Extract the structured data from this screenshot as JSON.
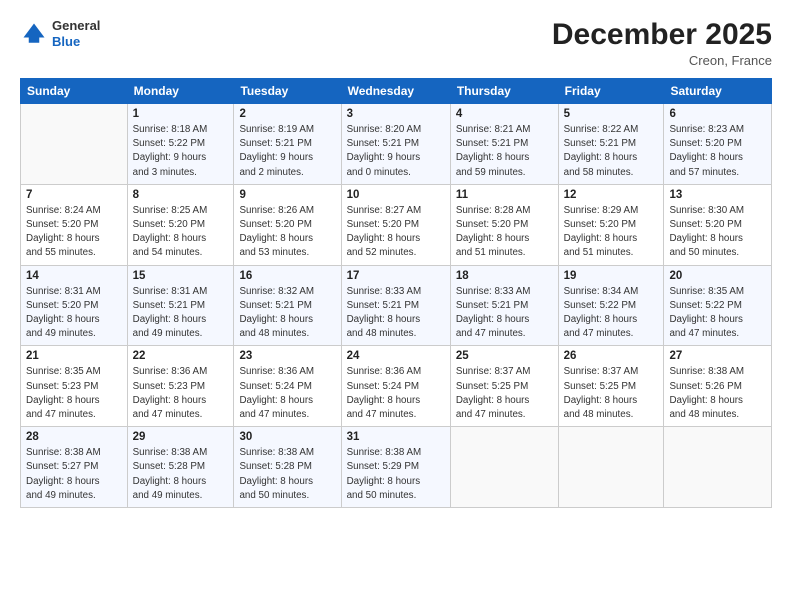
{
  "logo": {
    "general": "General",
    "blue": "Blue"
  },
  "title": "December 2025",
  "location": "Creon, France",
  "days_header": [
    "Sunday",
    "Monday",
    "Tuesday",
    "Wednesday",
    "Thursday",
    "Friday",
    "Saturday"
  ],
  "weeks": [
    [
      {
        "day": "",
        "info": ""
      },
      {
        "day": "1",
        "info": "Sunrise: 8:18 AM\nSunset: 5:22 PM\nDaylight: 9 hours\nand 3 minutes."
      },
      {
        "day": "2",
        "info": "Sunrise: 8:19 AM\nSunset: 5:21 PM\nDaylight: 9 hours\nand 2 minutes."
      },
      {
        "day": "3",
        "info": "Sunrise: 8:20 AM\nSunset: 5:21 PM\nDaylight: 9 hours\nand 0 minutes."
      },
      {
        "day": "4",
        "info": "Sunrise: 8:21 AM\nSunset: 5:21 PM\nDaylight: 8 hours\nand 59 minutes."
      },
      {
        "day": "5",
        "info": "Sunrise: 8:22 AM\nSunset: 5:21 PM\nDaylight: 8 hours\nand 58 minutes."
      },
      {
        "day": "6",
        "info": "Sunrise: 8:23 AM\nSunset: 5:20 PM\nDaylight: 8 hours\nand 57 minutes."
      }
    ],
    [
      {
        "day": "7",
        "info": "Sunrise: 8:24 AM\nSunset: 5:20 PM\nDaylight: 8 hours\nand 55 minutes."
      },
      {
        "day": "8",
        "info": "Sunrise: 8:25 AM\nSunset: 5:20 PM\nDaylight: 8 hours\nand 54 minutes."
      },
      {
        "day": "9",
        "info": "Sunrise: 8:26 AM\nSunset: 5:20 PM\nDaylight: 8 hours\nand 53 minutes."
      },
      {
        "day": "10",
        "info": "Sunrise: 8:27 AM\nSunset: 5:20 PM\nDaylight: 8 hours\nand 52 minutes."
      },
      {
        "day": "11",
        "info": "Sunrise: 8:28 AM\nSunset: 5:20 PM\nDaylight: 8 hours\nand 51 minutes."
      },
      {
        "day": "12",
        "info": "Sunrise: 8:29 AM\nSunset: 5:20 PM\nDaylight: 8 hours\nand 51 minutes."
      },
      {
        "day": "13",
        "info": "Sunrise: 8:30 AM\nSunset: 5:20 PM\nDaylight: 8 hours\nand 50 minutes."
      }
    ],
    [
      {
        "day": "14",
        "info": "Sunrise: 8:31 AM\nSunset: 5:20 PM\nDaylight: 8 hours\nand 49 minutes."
      },
      {
        "day": "15",
        "info": "Sunrise: 8:31 AM\nSunset: 5:21 PM\nDaylight: 8 hours\nand 49 minutes."
      },
      {
        "day": "16",
        "info": "Sunrise: 8:32 AM\nSunset: 5:21 PM\nDaylight: 8 hours\nand 48 minutes."
      },
      {
        "day": "17",
        "info": "Sunrise: 8:33 AM\nSunset: 5:21 PM\nDaylight: 8 hours\nand 48 minutes."
      },
      {
        "day": "18",
        "info": "Sunrise: 8:33 AM\nSunset: 5:21 PM\nDaylight: 8 hours\nand 47 minutes."
      },
      {
        "day": "19",
        "info": "Sunrise: 8:34 AM\nSunset: 5:22 PM\nDaylight: 8 hours\nand 47 minutes."
      },
      {
        "day": "20",
        "info": "Sunrise: 8:35 AM\nSunset: 5:22 PM\nDaylight: 8 hours\nand 47 minutes."
      }
    ],
    [
      {
        "day": "21",
        "info": "Sunrise: 8:35 AM\nSunset: 5:23 PM\nDaylight: 8 hours\nand 47 minutes."
      },
      {
        "day": "22",
        "info": "Sunrise: 8:36 AM\nSunset: 5:23 PM\nDaylight: 8 hours\nand 47 minutes."
      },
      {
        "day": "23",
        "info": "Sunrise: 8:36 AM\nSunset: 5:24 PM\nDaylight: 8 hours\nand 47 minutes."
      },
      {
        "day": "24",
        "info": "Sunrise: 8:36 AM\nSunset: 5:24 PM\nDaylight: 8 hours\nand 47 minutes."
      },
      {
        "day": "25",
        "info": "Sunrise: 8:37 AM\nSunset: 5:25 PM\nDaylight: 8 hours\nand 47 minutes."
      },
      {
        "day": "26",
        "info": "Sunrise: 8:37 AM\nSunset: 5:25 PM\nDaylight: 8 hours\nand 48 minutes."
      },
      {
        "day": "27",
        "info": "Sunrise: 8:38 AM\nSunset: 5:26 PM\nDaylight: 8 hours\nand 48 minutes."
      }
    ],
    [
      {
        "day": "28",
        "info": "Sunrise: 8:38 AM\nSunset: 5:27 PM\nDaylight: 8 hours\nand 49 minutes."
      },
      {
        "day": "29",
        "info": "Sunrise: 8:38 AM\nSunset: 5:28 PM\nDaylight: 8 hours\nand 49 minutes."
      },
      {
        "day": "30",
        "info": "Sunrise: 8:38 AM\nSunset: 5:28 PM\nDaylight: 8 hours\nand 50 minutes."
      },
      {
        "day": "31",
        "info": "Sunrise: 8:38 AM\nSunset: 5:29 PM\nDaylight: 8 hours\nand 50 minutes."
      },
      {
        "day": "",
        "info": ""
      },
      {
        "day": "",
        "info": ""
      },
      {
        "day": "",
        "info": ""
      }
    ]
  ]
}
